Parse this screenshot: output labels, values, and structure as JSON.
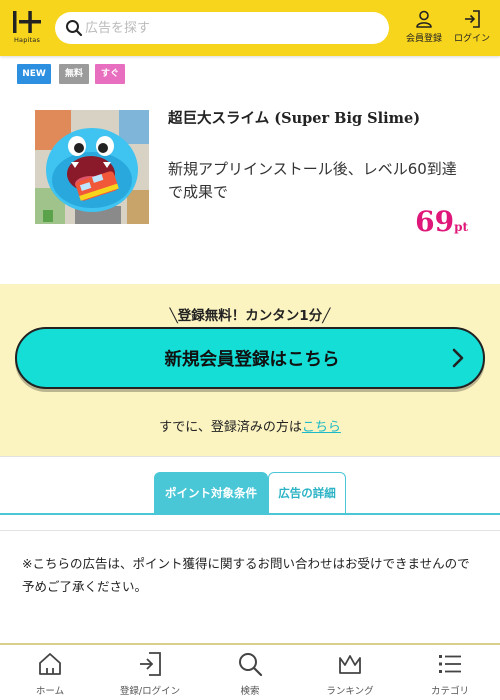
{
  "header": {
    "logo_text": "Hapitas",
    "search_placeholder": "広告を探す",
    "register_label": "会員登録",
    "login_label": "ログイン"
  },
  "badges": [
    "NEW",
    "無料",
    "すぐ"
  ],
  "ad": {
    "title": "超巨大スライム (Super Big Slime)",
    "description": "新規アプリインストール後、レベル60到達で成果で",
    "points": "69",
    "points_unit": "pt"
  },
  "signup": {
    "catch": "╲登録無料！カンタン1分╱",
    "button_label": "新規会員登録はこちら",
    "already_text": "すでに、登録済みの方は",
    "already_link": "こちら"
  },
  "tabs": [
    "ポイント対象条件",
    "広告の詳細"
  ],
  "notice": "※こちらの広告は、ポイント獲得に関するお問い合わせはお受けできませんので予めご了承ください。",
  "bottom_nav": [
    "ホーム",
    "登録/ログイン",
    "検索",
    "ランキング",
    "カテゴリ"
  ],
  "colors": {
    "header_bg": "#f7d51d",
    "signup_bg": "#fbf3c0",
    "cta": "#14ded6",
    "tab_accent": "#4ac7d6",
    "points": "#e0177a",
    "badge_new": "#2d8fe0",
    "badge_free": "#9b9b9b",
    "badge_soon": "#e86fc0"
  }
}
